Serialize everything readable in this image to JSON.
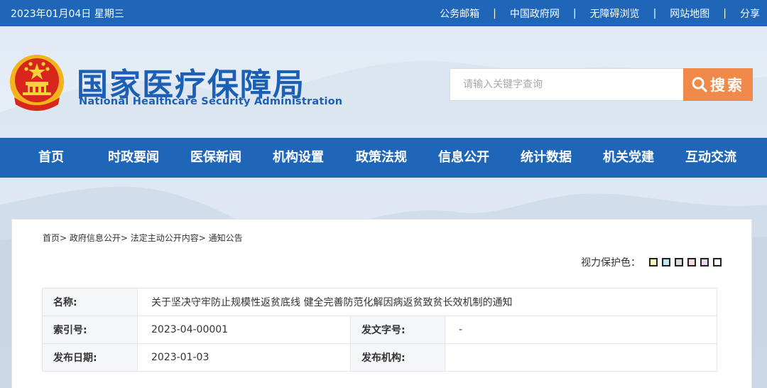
{
  "topbar": {
    "date": "2023年01月04日 星期三",
    "links": [
      "公务邮箱",
      "中国政府网",
      "无障碍浏览",
      "网站地图",
      "分享"
    ],
    "separator": "|"
  },
  "logo": {
    "cn": "国家医疗保障局",
    "en": "National Healthcare Security Administration"
  },
  "search": {
    "placeholder": "请输入关键字查询",
    "button_label": "搜索"
  },
  "nav": {
    "items": [
      "首页",
      "时政要闻",
      "医保新闻",
      "机构设置",
      "政策法规",
      "信息公开",
      "统计数据",
      "机关党建",
      "互动交流"
    ]
  },
  "breadcrumb": {
    "items": [
      "首页>",
      "政府信息公开>",
      "法定主动公开内容>",
      "通知公告"
    ]
  },
  "eye_protection": {
    "label": "视力保护色：",
    "colors": [
      "#fbf5c2",
      "#bfe6f3",
      "#dcdcdc",
      "#f8dcdc",
      "#e6d6f0",
      "#ffffff"
    ]
  },
  "info_table": {
    "name_label": "名称:",
    "name_value": "关于坚决守牢防止规模性返贫底线 健全完善防范化解因病返贫致贫长效机制的通知",
    "index_label": "索引号:",
    "index_value": "2023-04-00001",
    "doc_no_label": "发文字号:",
    "doc_no_value": "-",
    "date_label": "发布日期:",
    "date_value": "2023-01-03",
    "org_label": "发布机构:",
    "org_value": ""
  },
  "colors": {
    "primary_blue": "#1f66b9",
    "search_orange": "#f08a4b"
  }
}
